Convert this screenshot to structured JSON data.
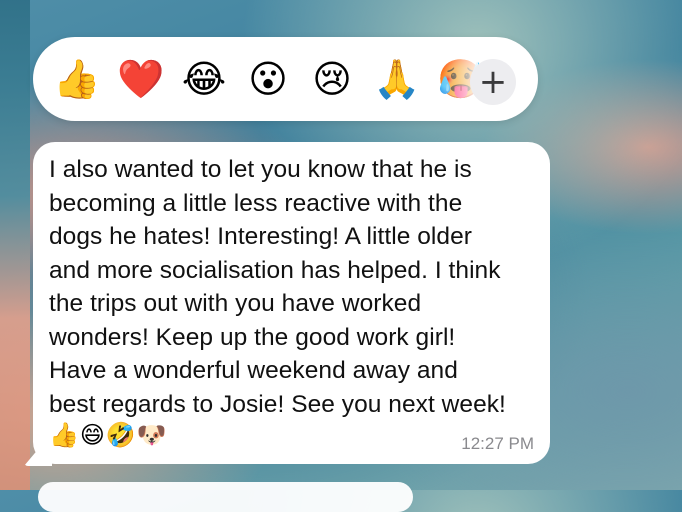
{
  "reactions": {
    "items": [
      {
        "name": "thumbs-up-icon",
        "glyph": "👍"
      },
      {
        "name": "red-heart-icon",
        "glyph": "❤️"
      },
      {
        "name": "tears-of-joy-icon",
        "glyph": "😂"
      },
      {
        "name": "surprised-face-icon",
        "glyph": "😮"
      },
      {
        "name": "crying-face-icon",
        "glyph": "😢"
      },
      {
        "name": "folded-hands-icon",
        "glyph": "🙏"
      },
      {
        "name": "hot-face-icon",
        "glyph": "🥵"
      }
    ],
    "add_label": "+"
  },
  "message": {
    "lines": [
      "I also wanted to let you know that he is",
      "becoming a little less reactive with the",
      "dogs he hates! Interesting! A little older",
      "and more socialisation has helped. I think",
      "the trips out with you have worked",
      "wonders! Keep up the good work girl!",
      "Have a wonderful weekend away and",
      "best regards to Josie! See you next week!"
    ],
    "emojis": "👍😄🤣🐶",
    "timestamp": "12:27 PM"
  },
  "colors": {
    "bubble": "#ffffff",
    "text": "#111111",
    "timestamp": "#8a8a8e",
    "add_button_bg": "#ededf0"
  }
}
